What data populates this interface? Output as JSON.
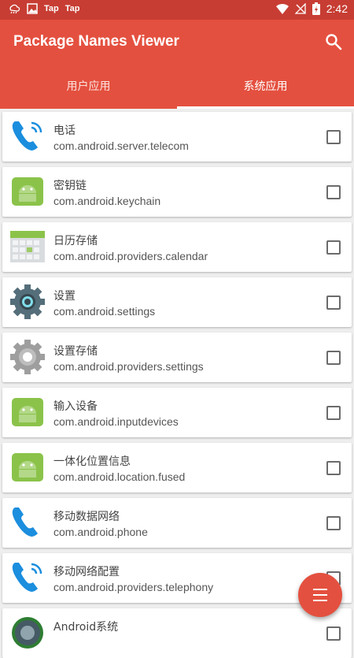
{
  "status_bar": {
    "notif_1": "Tap",
    "notif_2": "Tap",
    "time": "2:42"
  },
  "app_bar": {
    "title": "Package Names Viewer"
  },
  "tabs": [
    {
      "label": "用户应用",
      "active": false
    },
    {
      "label": "系统应用",
      "active": true
    }
  ],
  "items": [
    {
      "name": "电话",
      "package": "com.android.server.telecom",
      "icon": "phone-icon",
      "checked": false
    },
    {
      "name": "密钥链",
      "package": "com.android.keychain",
      "icon": "android-icon",
      "checked": false
    },
    {
      "name": "日历存储",
      "package": "com.android.providers.calendar",
      "icon": "calendar-icon",
      "checked": false
    },
    {
      "name": "设置",
      "package": "com.android.settings",
      "icon": "settings-gear-icon",
      "checked": false
    },
    {
      "name": "设置存储",
      "package": "com.android.providers.settings",
      "icon": "gear-icon",
      "checked": false
    },
    {
      "name": "输入设备",
      "package": "com.android.inputdevices",
      "icon": "android-icon",
      "checked": false
    },
    {
      "name": "一体化位置信息",
      "package": "com.android.location.fused",
      "icon": "android-icon",
      "checked": false
    },
    {
      "name": "移动数据网络",
      "package": "com.android.phone",
      "icon": "phone-icon",
      "checked": false
    },
    {
      "name": "移动网络配置",
      "package": "com.android.providers.telephony",
      "icon": "phone-icon",
      "checked": false
    },
    {
      "name": "Android系统",
      "package": "",
      "icon": "android-system-icon",
      "checked": false
    }
  ],
  "colors": {
    "primary": "#e4503f",
    "status_bar": "#c73d33",
    "background": "#eeeeee"
  },
  "fab": {
    "icon": "menu-icon"
  }
}
